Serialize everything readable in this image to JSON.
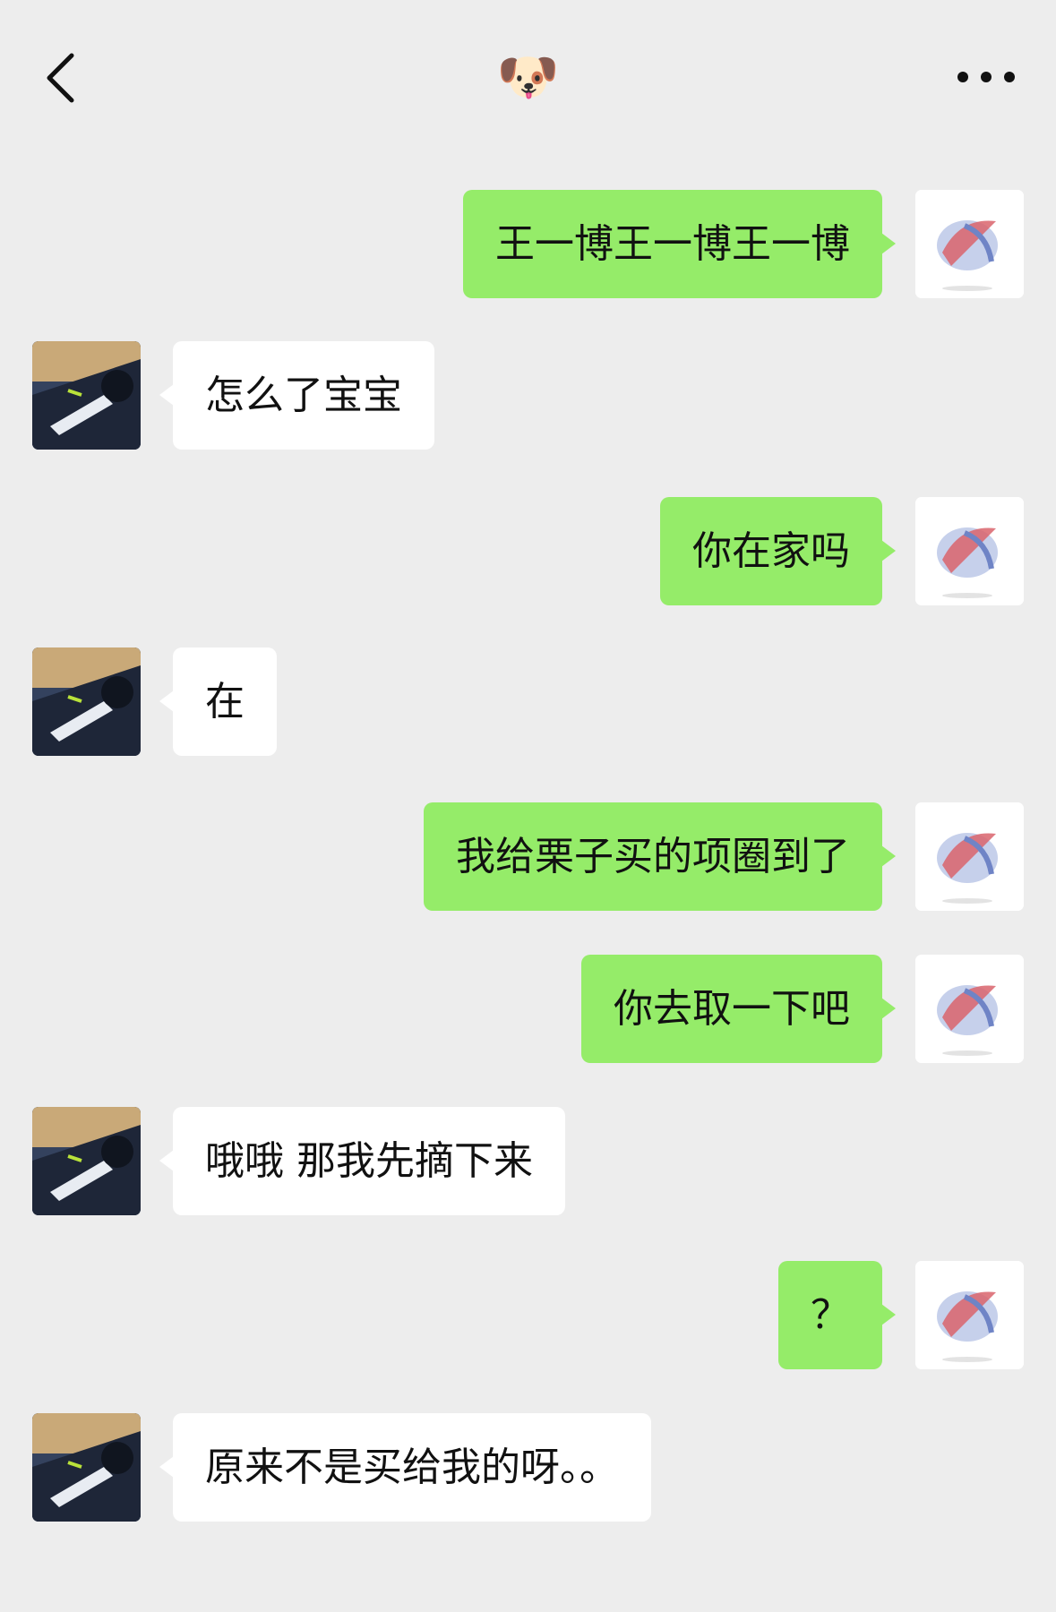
{
  "header": {
    "title": "🐶",
    "back_icon": "chevron-left-icon",
    "more_icon": "more-horizontal-icon"
  },
  "colors": {
    "background": "#ededed",
    "outgoing_bubble": "#95ec69",
    "incoming_bubble": "#ffffff"
  },
  "messages": [
    {
      "side": "me",
      "text": "王一博王一博王一博"
    },
    {
      "side": "them",
      "text": "怎么了宝宝"
    },
    {
      "side": "me",
      "text": "你在家吗"
    },
    {
      "side": "them",
      "text": "在"
    },
    {
      "side": "me",
      "text": "我给栗子买的项圈到了"
    },
    {
      "side": "me",
      "text": "你去取一下吧"
    },
    {
      "side": "them",
      "text": "哦哦 那我先摘下来"
    },
    {
      "side": "me",
      "text": "？"
    },
    {
      "side": "them",
      "text": "原来不是买给我的呀。。"
    }
  ]
}
